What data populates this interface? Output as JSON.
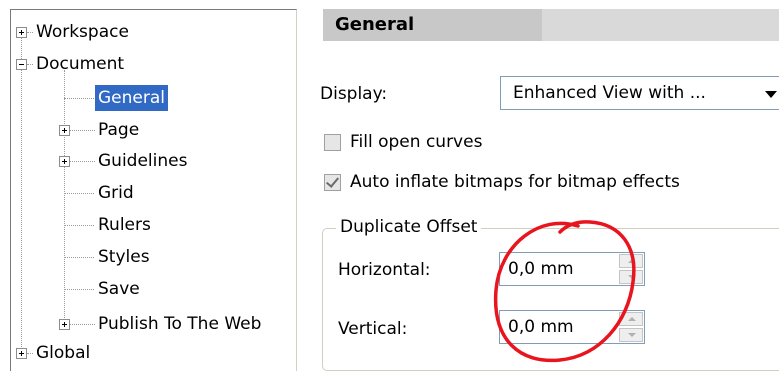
{
  "tree": {
    "items": [
      {
        "label": "Workspace",
        "expander": "plus"
      },
      {
        "label": "Document",
        "expander": "minus"
      },
      {
        "label": "General",
        "selected": true
      },
      {
        "label": "Page",
        "expander": "plus"
      },
      {
        "label": "Guidelines",
        "expander": "plus"
      },
      {
        "label": "Grid"
      },
      {
        "label": "Rulers"
      },
      {
        "label": "Styles"
      },
      {
        "label": "Save"
      },
      {
        "label": "Publish To The Web",
        "expander": "plus"
      },
      {
        "label": "Global",
        "expander": "plus"
      }
    ]
  },
  "header": {
    "title": "General"
  },
  "display": {
    "label": "Display:",
    "value": "Enhanced View with ..."
  },
  "options": {
    "fill_open_curves": {
      "label": "Fill open curves",
      "checked": false
    },
    "auto_inflate": {
      "label": "Auto inflate bitmaps for bitmap effects",
      "checked": true
    }
  },
  "duplicate_offset": {
    "title": "Duplicate Offset",
    "horizontal": {
      "label": "Horizontal:",
      "value": "0,0 mm"
    },
    "vertical": {
      "label": "Vertical:",
      "value": "0,0 mm"
    }
  },
  "colors": {
    "selection": "#316ac5",
    "annotation": "#e8141e"
  }
}
